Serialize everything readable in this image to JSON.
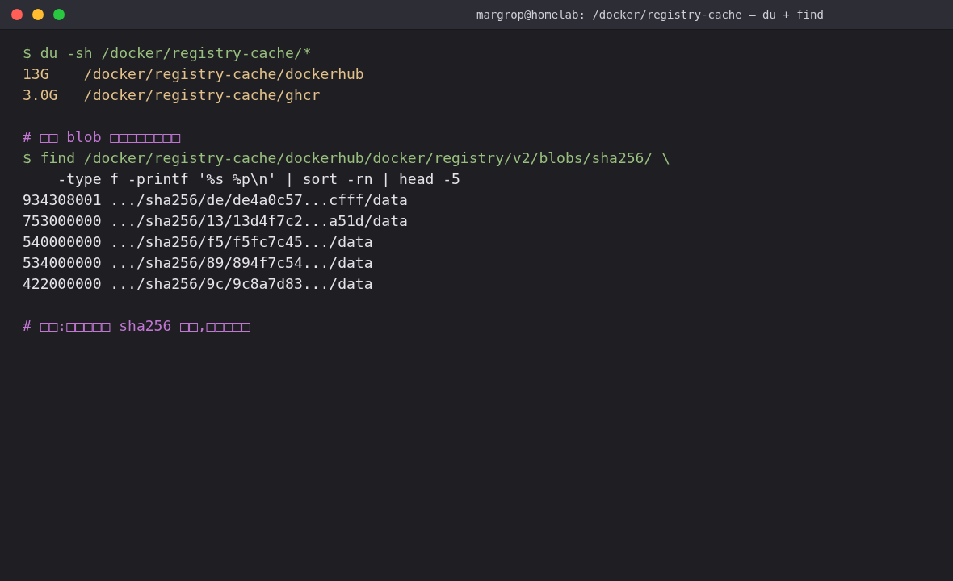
{
  "window": {
    "title": "margrop@homelab: /docker/registry-cache — du + find"
  },
  "blocks": [
    {
      "lines": [
        {
          "kind": "command",
          "text": "$ du -sh /docker/registry-cache/*"
        },
        {
          "kind": "du_output",
          "text": "13G    /docker/registry-cache/dockerhub"
        },
        {
          "kind": "du_output",
          "text": "3.0G   /docker/registry-cache/ghcr"
        }
      ]
    },
    {
      "lines": [
        {
          "kind": "comment",
          "text": "# □□ blob □□□□□□□□"
        },
        {
          "kind": "command",
          "text": "$ find /docker/registry-cache/dockerhub/docker/registry/v2/blobs/sha256/ \\"
        },
        {
          "kind": "continuation",
          "text": "    -type f -printf '%s %p\\n' | sort -rn | head -5"
        },
        {
          "kind": "output",
          "text": "934308001 .../sha256/de/de4a0c57...cfff/data"
        },
        {
          "kind": "output",
          "text": "753000000 .../sha256/13/13d4f7c2...a51d/data"
        },
        {
          "kind": "output",
          "text": "540000000 .../sha256/f5/f5fc7c45.../data"
        },
        {
          "kind": "output",
          "text": "534000000 .../sha256/89/894f7c54.../data"
        },
        {
          "kind": "output",
          "text": "422000000 .../sha256/9c/9c8a7d83.../data"
        }
      ]
    },
    {
      "lines": [
        {
          "kind": "comment",
          "text": "# □□:□□□□□ sha256 □□,□□□□□"
        }
      ]
    }
  ]
}
